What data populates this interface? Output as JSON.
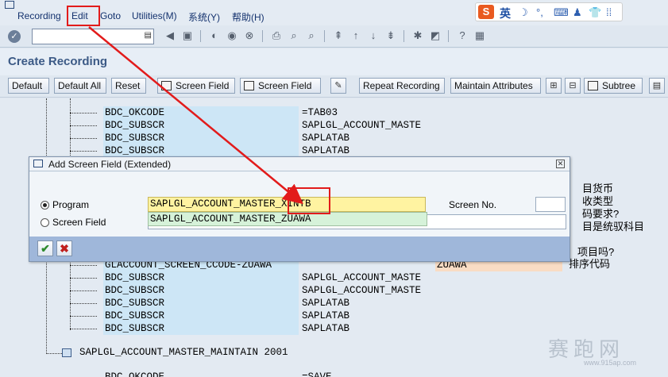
{
  "menu": {
    "items": [
      "Recording",
      "Edit",
      "Goto",
      "Utilities(M)",
      "系统(Y)",
      "帮助(H)"
    ],
    "ime_logo": "S",
    "ime_label": "英",
    "ime_glyphs": [
      "☽",
      "°,",
      "⌨",
      "♟",
      "👕",
      "⁞⁞"
    ]
  },
  "toolbar": {
    "command_value": ""
  },
  "title": "Create Recording",
  "app_buttons": {
    "default": "Default",
    "default_all": "Default All",
    "reset": "Reset",
    "screen_field_1": "Screen Field",
    "screen_field_2": "Screen Field",
    "repeat_recording": "Repeat Recording",
    "maintain_attributes": "Maintain Attributes",
    "subtree": "Subtree"
  },
  "tree_rows_top": [
    {
      "field": "BDC_OKCODE",
      "value": "=TAB03"
    },
    {
      "field": "BDC_SUBSCR",
      "value": "SAPLGL_ACCOUNT_MASTE"
    },
    {
      "field": "BDC_SUBSCR",
      "value": "SAPLATAB"
    },
    {
      "field": "BDC_SUBSCR",
      "value": "SAPLATAB"
    }
  ],
  "tree_rows_bottom": [
    {
      "field": "GLACCOUNT_SCREEN_CCODE-ZUAWA",
      "value": "ZUAWA",
      "note": "排序代码"
    },
    {
      "field": "BDC_SUBSCR",
      "value": "SAPLGL_ACCOUNT_MASTE"
    },
    {
      "field": "BDC_SUBSCR",
      "value": "SAPLGL_ACCOUNT_MASTE"
    },
    {
      "field": "BDC_SUBSCR",
      "value": "SAPLATAB"
    },
    {
      "field": "BDC_SUBSCR",
      "value": "SAPLATAB"
    },
    {
      "field": "BDC_SUBSCR",
      "value": "SAPLATAB"
    }
  ],
  "side_notes": [
    "目货币",
    "收类型",
    "码要求?",
    "目是统驭科目",
    "项目吗?"
  ],
  "tree_node": "SAPLGL_ACCOUNT_MASTER_MAINTAIN 2001",
  "tree_bottom_row": "BDC_OKCODE",
  "tree_bottom_value": "=SAVE",
  "dialog": {
    "title": "Add Screen Field (Extended)",
    "program_label": "Program",
    "program_value": "SAPLGL_ACCOUNT_MASTER_XINTB",
    "suggestion": "SAPLGL_ACCOUNT_MASTER_ZUAWA",
    "screen_no_label": "Screen No.",
    "screen_no_value": "",
    "screen_field_label": "Screen Field",
    "screen_field_value": ""
  },
  "watermark": "赛跑网",
  "watermark_url": "www.915ap.com"
}
